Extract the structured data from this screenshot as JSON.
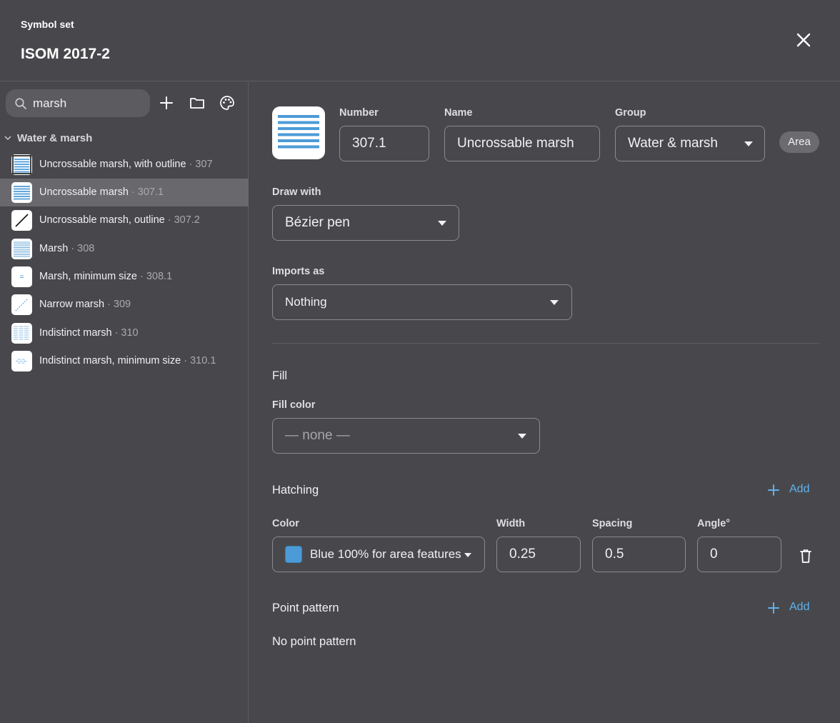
{
  "header": {
    "subtitle": "Symbol set",
    "title": "ISOM 2017-2",
    "close_icon": "close-icon"
  },
  "sidebar": {
    "search": {
      "value": "marsh"
    },
    "tools": [
      "add-icon",
      "folder-icon",
      "palette-icon"
    ],
    "group": {
      "label": "Water & marsh",
      "icon": "chevron-down-icon"
    },
    "items": [
      {
        "name": "Uncrossable marsh, with outline",
        "number": " · 307",
        "thumb": "outlined-hatch"
      },
      {
        "name": "Uncrossable marsh",
        "number": " · 307.1",
        "thumb": "dense-hatch",
        "selected": true
      },
      {
        "name": "Uncrossable marsh, outline",
        "number": " · 307.2",
        "thumb": "diagonal-line"
      },
      {
        "name": "Marsh",
        "number": " · 308",
        "thumb": "fine-hatch"
      },
      {
        "name": "Marsh, minimum size",
        "number": " · 308.1",
        "thumb": "small-dashes"
      },
      {
        "name": "Narrow marsh",
        "number": " · 309",
        "thumb": "dotted-diagonal"
      },
      {
        "name": "Indistinct marsh",
        "number": " · 310",
        "thumb": "broken-hatch"
      },
      {
        "name": "Indistinct marsh, minimum size",
        "number": " · 310.1",
        "thumb": "broken-small"
      }
    ]
  },
  "symbol": {
    "number_label": "Number",
    "number": "307.1",
    "name_label": "Name",
    "name": "Uncrossable marsh",
    "group_label": "Group",
    "group": "Water & marsh",
    "type_badge": "Area",
    "draw_with_label": "Draw with",
    "draw_with": "Bézier pen",
    "imports_as_label": "Imports as",
    "imports_as": "Nothing"
  },
  "fill": {
    "section_title": "Fill",
    "color_label": "Fill color",
    "color_value": "— none —"
  },
  "hatching": {
    "section_title": "Hatching",
    "add_label": "Add",
    "color_label": "Color",
    "color_value": "Blue 100% for area features",
    "swatch_color": "#4c9bd8",
    "width_label": "Width",
    "width": "0.25",
    "spacing_label": "Spacing",
    "spacing": "0.5",
    "angle_label": "Angle°",
    "angle": "0"
  },
  "point_pattern": {
    "section_title": "Point pattern",
    "add_label": "Add",
    "empty_text": "No point pattern"
  },
  "colors": {
    "accent": "#5eb1ec",
    "marsh_blue": "#4c9bd8",
    "background": "#48484c"
  }
}
